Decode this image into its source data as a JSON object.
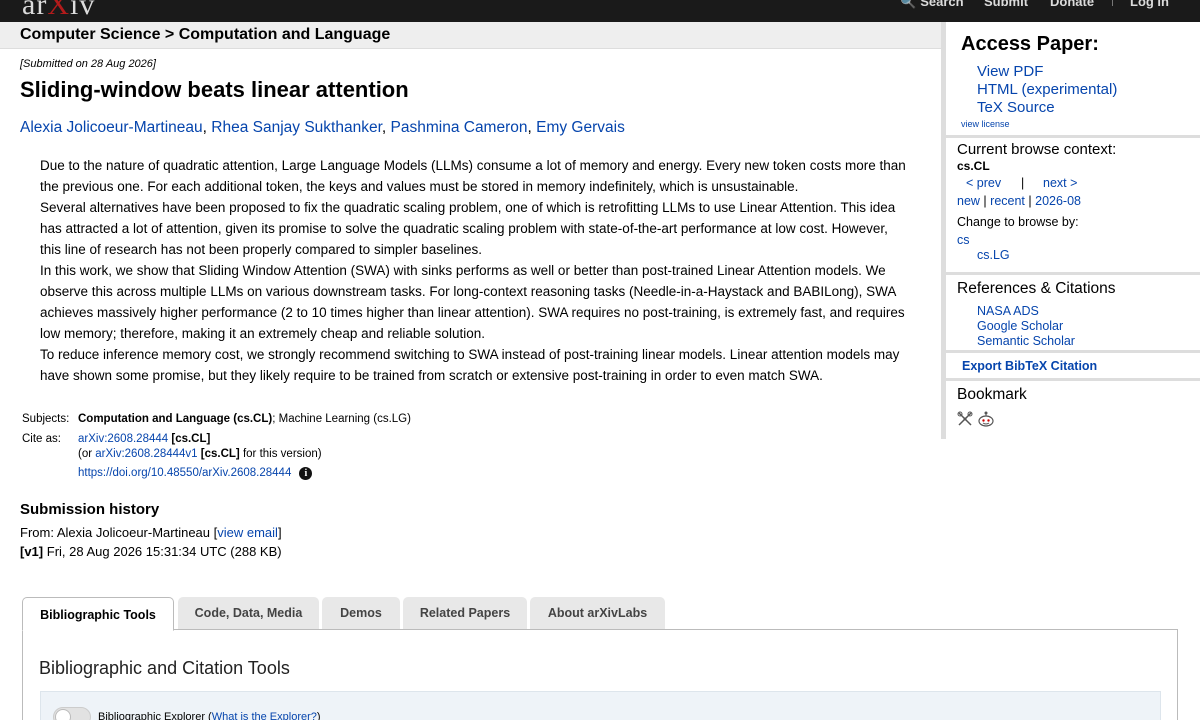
{
  "header": {
    "logo_prefix": "ar",
    "logo_x": "X",
    "logo_suffix": "iv",
    "nav": {
      "search": "Search",
      "submit": "Submit",
      "donate": "Donate",
      "login": "Log in"
    }
  },
  "breadcrumb": "Computer Science > Computation and Language",
  "paper": {
    "submitted": "[Submitted on 28 Aug 2026]",
    "title": "Sliding-window beats linear attention",
    "authors": [
      "Alexia Jolicoeur-Martineau",
      "Rhea Sanjay Sukthanker",
      "Pashmina Cameron",
      "Emy Gervais"
    ],
    "abstract": [
      "Due to the nature of quadratic attention, Large Language Models (LLMs) consume a lot of memory and energy. Every new token costs more than the previous one. For each additional token, the keys and values must be stored in memory indefinitely, which is unsustainable.",
      "Several alternatives have been proposed to fix the quadratic scaling problem, one of which is retrofitting LLMs to use Linear Attention. This idea has attracted a lot of attention, given its promise to solve the quadratic scaling problem with state-of-the-art performance at low cost. However, this line of research has not been properly compared to simpler baselines.",
      "In this work, we show that Sliding Window Attention (SWA) with sinks performs as well or better than post-trained Linear Attention models. We observe this across multiple LLMs on various downstream tasks. For long-context reasoning tasks (Needle-in-a-Haystack and BABILong), SWA achieves massively higher performance (2 to 10 times higher than linear attention). SWA requires no post-training, is extremely fast, and requires low memory; therefore, making it an extremely cheap and reliable solution.",
      "To reduce inference memory cost, we strongly recommend switching to SWA instead of post-training linear models. Linear attention models may have shown some promise, but they likely require to be trained from scratch or extensive post-training in order to even match SWA."
    ]
  },
  "metadata": {
    "subjects_label": "Subjects:",
    "subjects_primary": "Computation and Language (cs.CL)",
    "subjects_rest": "; Machine Learning (cs.LG)",
    "cite_label": "Cite as:",
    "cite_id": "arXiv:2608.28444",
    "cite_cat": "[cs.CL]",
    "cite_or": "(or",
    "cite_version_id": "arXiv:2608.28444v1",
    "cite_version_cat": "[cs.CL]",
    "cite_version_suffix": "for this version)",
    "doi": "https://doi.org/10.48550/arXiv.2608.28444",
    "info_glyph": "i"
  },
  "history": {
    "heading": "Submission history",
    "from_label": "From: Alexia Jolicoeur-Martineau [",
    "view_email": "view email",
    "from_close": "]",
    "v1_label": "[v1]",
    "v1_text": "Fri, 28 Aug 2026 15:31:34 UTC (288 KB)"
  },
  "tabs": [
    "Bibliographic Tools",
    "Code, Data, Media",
    "Demos",
    "Related Papers",
    "About arXivLabs"
  ],
  "panel": {
    "heading": "Bibliographic and Citation Tools",
    "explorer_label": "Bibliographic Explorer (",
    "explorer_link": "What is the Explorer?",
    "explorer_close": ")"
  },
  "sidebar": {
    "access_heading": "Access Paper:",
    "access_links": [
      "View PDF",
      "HTML (experimental)",
      "TeX Source"
    ],
    "view_license": "view license",
    "context_heading": "Current browse context:",
    "context_category": "cs.CL",
    "prev": "< prev",
    "separator": "|",
    "next": "next >",
    "new": "new",
    "recent": "recent",
    "month": "2026-08",
    "change_label": "Change to browse by:",
    "browse_cs": "cs",
    "browse_cslg": "cs.LG",
    "refs_heading": "References & Citations",
    "refs_links": [
      "NASA ADS",
      "Google Scholar",
      "Semantic Scholar"
    ],
    "export_bibtex": "Export BibTeX Citation",
    "bookmark_heading": "Bookmark",
    "bookmark_icons": [
      "bibsonomy-icon",
      "reddit-icon"
    ]
  }
}
